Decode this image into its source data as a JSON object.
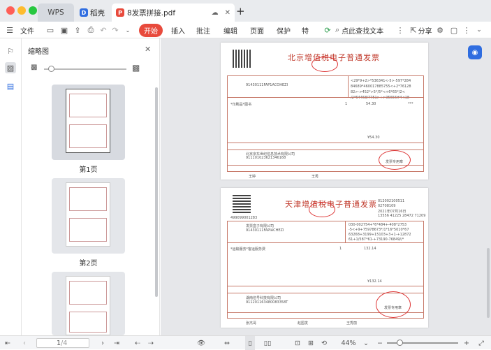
{
  "window": {
    "tabs": [
      {
        "label": "WPS"
      },
      {
        "label": "稻壳"
      },
      {
        "label": "8发票拼接.pdf"
      }
    ],
    "colors": {
      "accent": "#e84a3c",
      "invoice_red": "#c0392b"
    }
  },
  "toolbar": {
    "file_label": "文件",
    "start_label": "开始",
    "insert_label": "插入",
    "annotate_label": "批注",
    "edit_label": "编辑",
    "page_label": "页面",
    "protect_label": "保护",
    "special_label": "特",
    "find_label": "点此查找文本",
    "share_label": "分享"
  },
  "thumbnails": {
    "title": "缩略图",
    "pages": [
      {
        "label": "第1页"
      },
      {
        "label": "第2页"
      }
    ]
  },
  "document": {
    "invoice1": {
      "title": "北京增值税电子普通发票",
      "seller_stamp": "发票专用章",
      "amount": "¥54.30",
      "tax_mark": "***",
      "code_cipher": [
        "<29*9+2>*536341<-5>-597*284",
        "84689*460017885755<+2*76128",
        "82>->452*>5*/5*<+6*65*/2<",
        "/2*64468/7751>+>95656#4<18"
      ],
      "buyer_id": "91430111FAP1ACOHEZI",
      "item_name": "*印刷品*图书",
      "qty": "1",
      "price": "54.30",
      "seller_name": "北京京东世纪信息技术有限公司",
      "seller_id": "911101023621346168",
      "payee": "王婷",
      "reviewer": "王秀"
    },
    "invoice2": {
      "title": "天津增值税电子普通发票",
      "invoice_code": "012002100511",
      "invoice_no": "02708109",
      "date": "2021年07月16日",
      "check": "13556 41225 28472 71209",
      "machine_no": "499099001283",
      "buyer": "发票盒子有限公司",
      "buyer_id": "91430111FAPIACHEZI",
      "cipher": [
        "030-002754+*6*484+-408*2753",
        "-5<+9+75978673*/1*16*5010*67",
        "63268+3199+15103+3+1-+12872",
        "61+1/587*61-+73190-76849//*"
      ],
      "item_name": "*运输服务*客运服务费",
      "qty": "1",
      "amount": "132.14",
      "total": "¥132.14",
      "seller": "湖南信号科技有限公司",
      "seller_id": "911201163480083358T",
      "payee": "张杰哥",
      "reviewer": "赵国发",
      "drawer": "王秀丽",
      "stamp_text": "发票专用章"
    }
  },
  "statusbar": {
    "page_input": "1",
    "page_total": "/4",
    "zoom": "44%"
  }
}
